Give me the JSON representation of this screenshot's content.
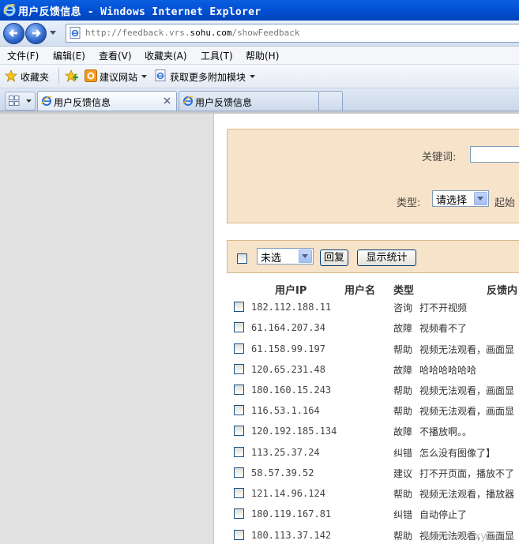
{
  "window": {
    "title": "用户反馈信息 - Windows Internet Explorer"
  },
  "address": {
    "url_prefix": "http://feedback.vrs.",
    "url_domain": "sohu.com",
    "url_suffix": "/showFeedback"
  },
  "menu": [
    "文件(F)",
    "编辑(E)",
    "查看(V)",
    "收藏夹(A)",
    "工具(T)",
    "帮助(H)"
  ],
  "favbar": {
    "favorites": "收藏夹",
    "suggested": "建议网站",
    "addons": "获取更多附加模块"
  },
  "tabs": [
    {
      "label": "用户反馈信息",
      "active": true
    },
    {
      "label": "用户反馈信息",
      "active": false
    }
  ],
  "search": {
    "keyword_label": "关键词:",
    "type_label": "类型:",
    "type_value": "请选择",
    "start_label": "起始"
  },
  "actions": {
    "select_value": "未选",
    "reply_button": "回复",
    "stats_button": "显示统计"
  },
  "table": {
    "headers": {
      "ip": "用户IP",
      "user": "用户名",
      "type": "类型",
      "content": "反馈内"
    },
    "rows": [
      {
        "ip": "182.112.188.11",
        "type": "咨询",
        "msg": "打不开视频"
      },
      {
        "ip": "61.164.207.34",
        "type": "故障",
        "msg": "视频看不了"
      },
      {
        "ip": "61.158.99.197",
        "type": "帮助",
        "msg": "视频无法观看，画面显"
      },
      {
        "ip": "120.65.231.48",
        "type": "故障",
        "msg": "哈哈哈哈哈哈"
      },
      {
        "ip": "180.160.15.243",
        "type": "帮助",
        "msg": "视频无法观看，画面显"
      },
      {
        "ip": "116.53.1.164",
        "type": "帮助",
        "msg": "视频无法观看，画面显"
      },
      {
        "ip": "120.192.185.134",
        "type": "故障",
        "msg": "不播放啊。。"
      },
      {
        "ip": "113.25.37.24",
        "type": "纠错",
        "msg": "怎么没有图像了】"
      },
      {
        "ip": "58.57.39.52",
        "type": "建议",
        "msg": "打不开页面，播放不了"
      },
      {
        "ip": "121.14.96.124",
        "type": "帮助",
        "msg": "视频无法观看，播放器"
      },
      {
        "ip": "180.119.167.81",
        "type": "纠错",
        "msg": "自动停止了"
      },
      {
        "ip": "180.113.37.142",
        "type": "帮助",
        "msg": "视频无法观看，画面显"
      }
    ]
  },
  "watermark": "www.wocxy.net"
}
